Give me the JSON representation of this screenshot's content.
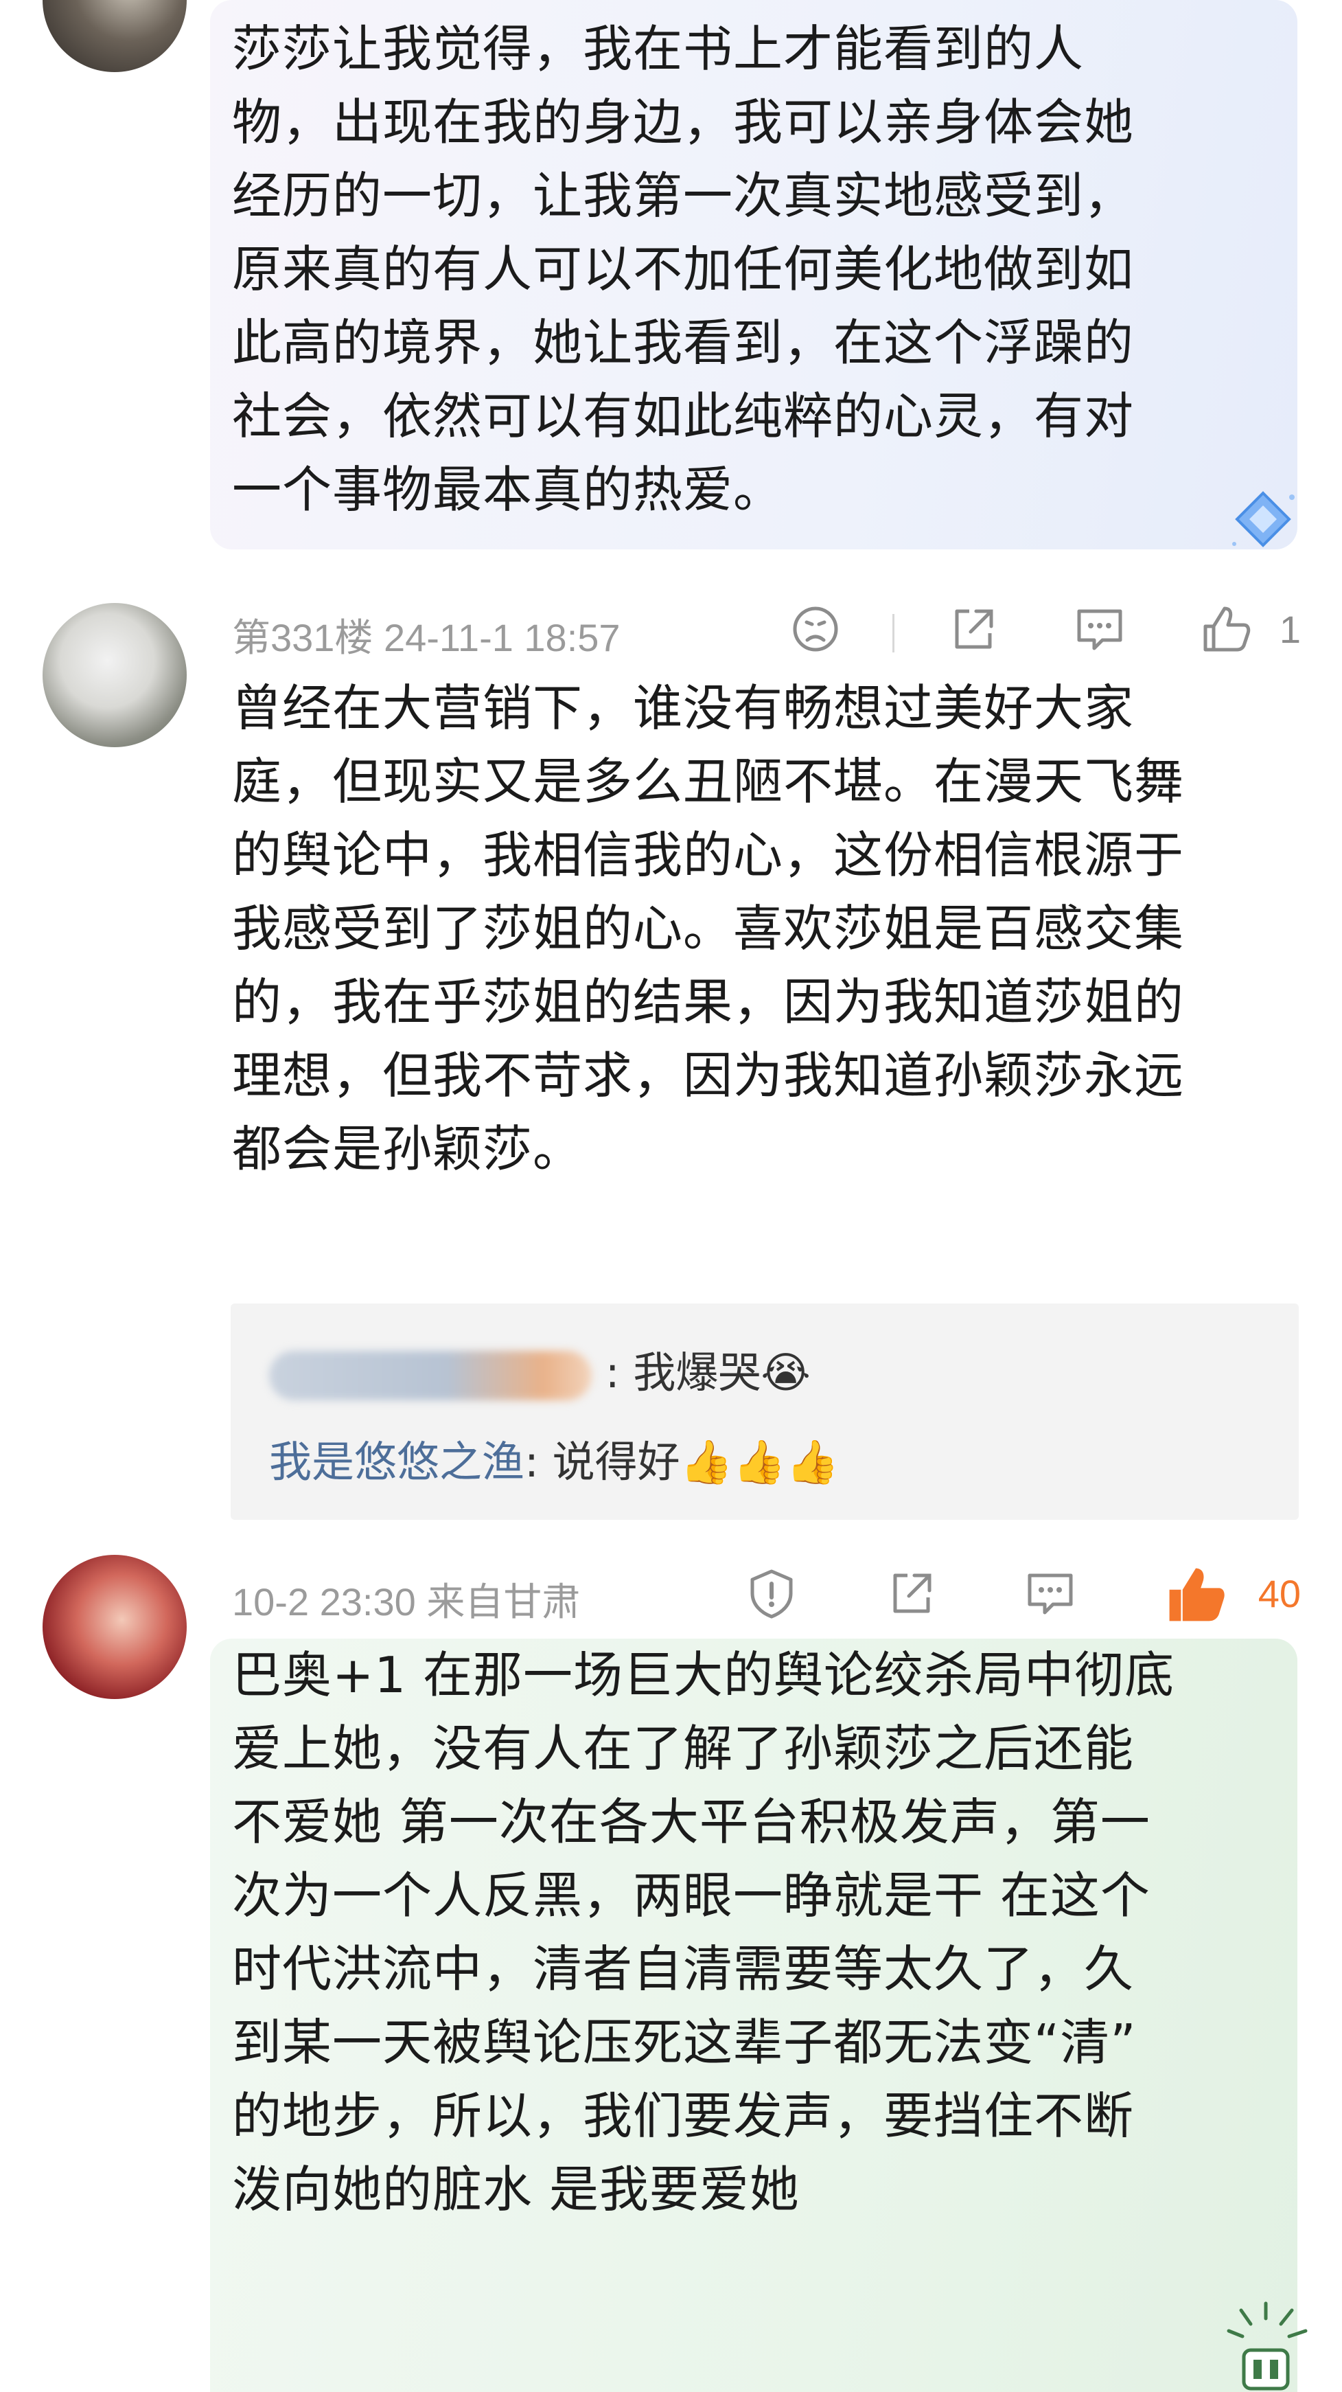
{
  "comments": [
    {
      "text": "莎莎让我觉得，我在书上才能看到的人\n物，出现在我的身边，我可以亲身体会她\n经历的一切，让我第一次真实地感受到，\n原来真的有人可以不加任何美化地做到如\n此高的境界，她让我看到，在这个浮躁的\n社会，依然可以有如此纯粹的心灵，有对\n一个事物最本真的热爱。",
      "floor_time": "第331楼 24-11-1 18:57",
      "likes": "1",
      "bubble_color": "#edf2fb"
    },
    {
      "text": "曾经在大营销下，谁没有畅想过美好大家\n庭，但现实又是多么丑陋不堪。在漫天飞舞\n的舆论中，我相信我的心，这份相信根源于\n我感受到了莎姐的心。喜欢莎姐是百感交集\n的，我在乎莎姐的结果，因为我知道莎姐的\n理想，但我不苛求，因为我知道孙颖莎永远\n都会是孙颖莎。",
      "replies": [
        {
          "name": "",
          "text": ": 我爆哭😭"
        },
        {
          "name": "我是悠悠之渔",
          "text": ": 说得好👍👍👍"
        }
      ],
      "time_location": "10-2 23:30 来自甘肃",
      "likes": "40",
      "like_color": "#f4772b"
    },
    {
      "text": "巴奥+1 在那一场巨大的舆论绞杀局中彻底\n爱上她，没有人在了解了孙颖莎之后还能\n不爱她 第一次在各大平台积极发声，第一\n次为一个人反黑，两眼一睁就是干 在这个\n时代洪流中，清者自清需要等太久了，久\n到某一天被舆论压死这辈子都无法变“清”\n的地步，所以，我们要发声，要挡住不断\n泼向她的脏水 是我要爱她",
      "bubble_color": "#e9f5ea"
    }
  ]
}
